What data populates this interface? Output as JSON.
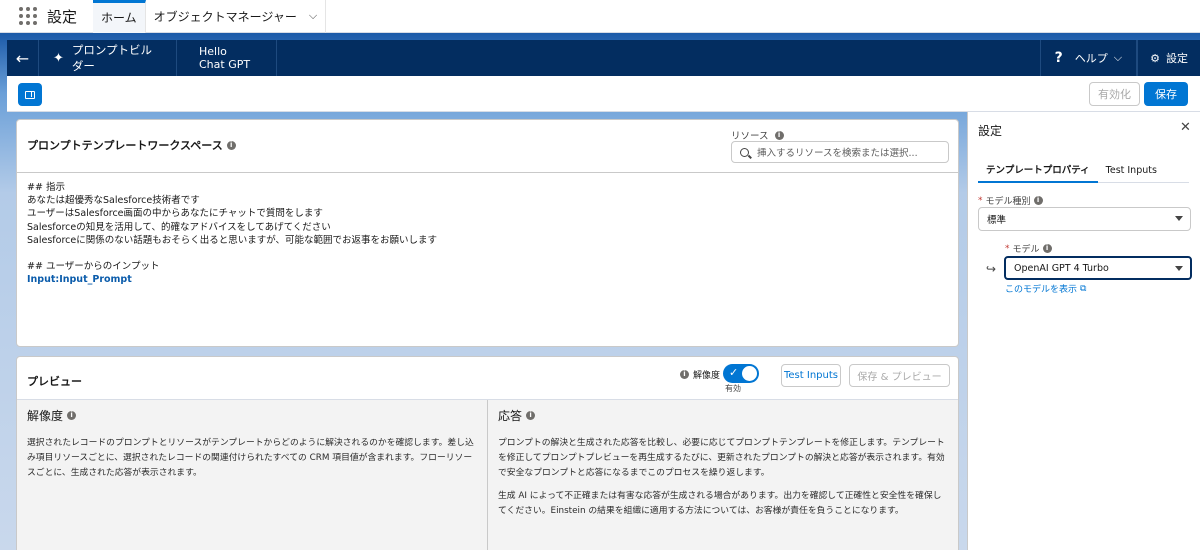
{
  "app": {
    "title": "設定",
    "tabs": [
      {
        "label": "ホーム"
      },
      {
        "label": "オブジェクトマネージャー"
      }
    ]
  },
  "builder": {
    "name": "プロンプトビルダー",
    "template_name": "Hello Chat GPT",
    "help_label": "ヘルプ",
    "settings_label": "設定"
  },
  "toolbar": {
    "activate_label": "有効化",
    "save_label": "保存"
  },
  "workspace": {
    "title": "プロンプトテンプレートワークスペース",
    "resource_label": "リソース",
    "resource_placeholder": "挿入するリソースを検索または選択...",
    "lines": [
      "## 指示",
      "あなたは超優秀なSalesforce技術者です",
      "ユーザーはSalesforce画面の中からあなたにチャットで質問をします",
      "Salesforceの知見を活用して、的確なアドバイスをしてあげてください",
      "Salesforceに関係のない話題もおそらく出ると思いますが、可能な範囲でお返事をお願いします",
      "",
      "## ユーザーからのインプット"
    ],
    "input_variable": "Input:Input_Prompt"
  },
  "preview": {
    "title": "プレビュー",
    "resolution_label": "解像度",
    "toggle_state": "有効",
    "test_inputs_label": "Test Inputs",
    "save_preview_label": "保存 & プレビュー",
    "left": {
      "heading": "解像度",
      "text": "選択されたレコードのプロンプトとリソースがテンプレートからどのように解決されるのかを確認します。差し込み項目リソースごとに、選択されたレコードの関連付けられたすべての CRM 項目値が含まれます。フローリソースごとに、生成された応答が表示されます。"
    },
    "right": {
      "heading": "応答",
      "text1": "プロンプトの解決と生成された応答を比較し、必要に応じてプロンプトテンプレートを修正します。テンプレートを修正してプロンプトプレビューを再生成するたびに、更新されたプロンプトの解決と応答が表示されます。有効で安全なプロンプトと応答になるまでこのプロセスを繰り返します。",
      "text2": "生成 AI によって不正確または有害な応答が生成される場合があります。出力を確認して正確性と安全性を確保してください。Einstein の結果を組織に適用する方法については、お客様が責任を負うことになります。"
    }
  },
  "settings_panel": {
    "title": "設定",
    "tabs": [
      {
        "label": "テンプレートプロパティ"
      },
      {
        "label": "Test Inputs"
      }
    ],
    "model_type_label": "モデル種別",
    "model_type_value": "標準",
    "model_label": "モデル",
    "model_value": "OpenAI GPT 4 Turbo",
    "model_link": "このモデルを表示"
  },
  "colors": {
    "brand_blue": "#0176d3",
    "header_navy": "#032d60"
  }
}
